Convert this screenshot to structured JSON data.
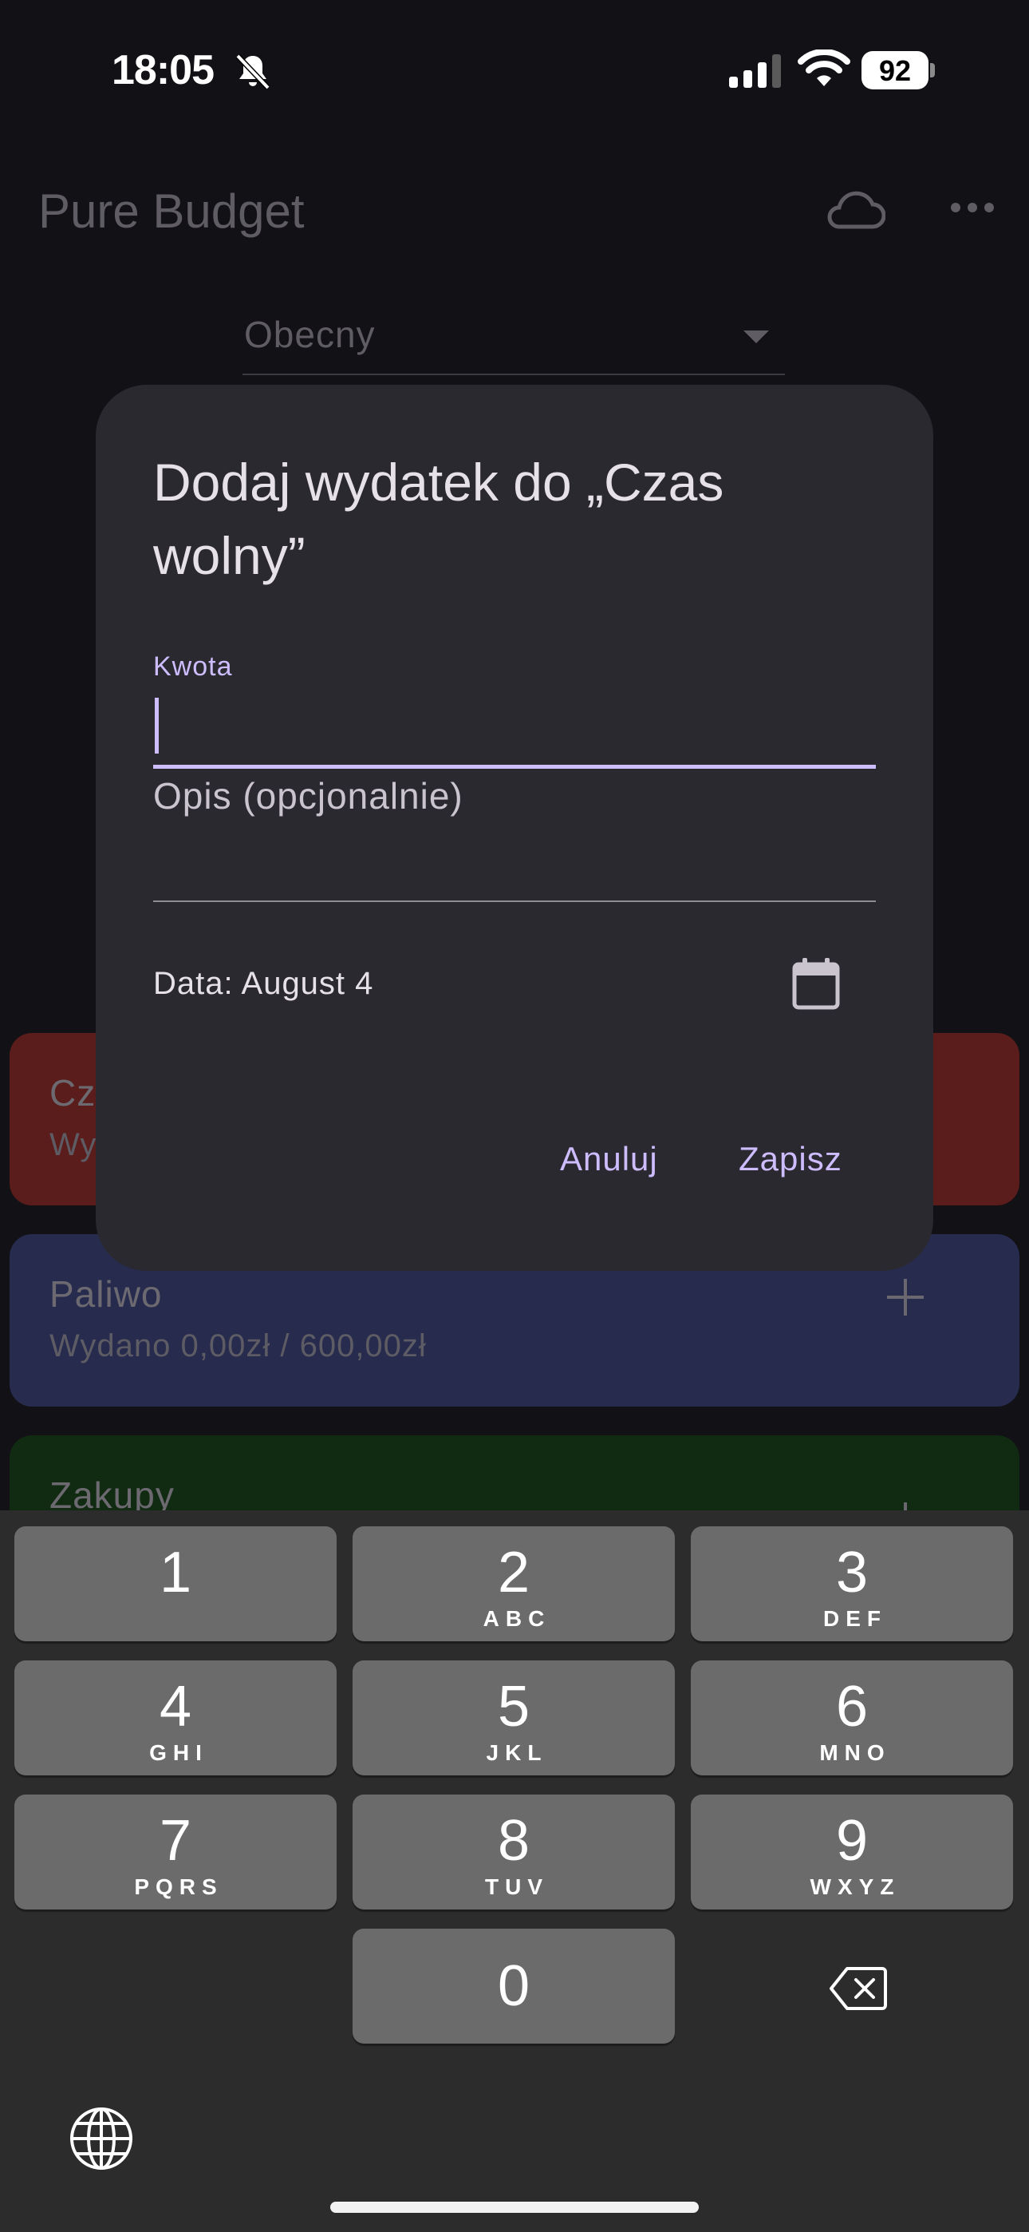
{
  "status_bar": {
    "time": "18:05",
    "battery": "92"
  },
  "app": {
    "title": "Pure Budget",
    "period": "Obecny"
  },
  "categories": [
    {
      "name": "Cz",
      "subtitle": "Wy"
    },
    {
      "name": "Paliwo",
      "subtitle": "Wydano 0,00zł / 600,00zł"
    },
    {
      "name": "Zakupy",
      "subtitle": ""
    }
  ],
  "dialog": {
    "title": "Dodaj wydatek do „Czas wolny”",
    "amount_label": "Kwota",
    "amount_value": "",
    "description_placeholder": "Opis (opcjonalnie)",
    "date_label": "Data: August 4",
    "cancel": "Anuluj",
    "save": "Zapisz"
  },
  "keyboard": {
    "keys": [
      {
        "digit": "1",
        "letters": ""
      },
      {
        "digit": "2",
        "letters": "ABC"
      },
      {
        "digit": "3",
        "letters": "DEF"
      },
      {
        "digit": "4",
        "letters": "GHI"
      },
      {
        "digit": "5",
        "letters": "JKL"
      },
      {
        "digit": "6",
        "letters": "MNO"
      },
      {
        "digit": "7",
        "letters": "PQRS"
      },
      {
        "digit": "8",
        "letters": "TUV"
      },
      {
        "digit": "9",
        "letters": "WXYZ"
      },
      {
        "digit": "0",
        "letters": ""
      }
    ]
  },
  "colors": {
    "accent": "#cdbdff",
    "dialog_bg": "#2b2930",
    "card_red": "#5a1d1b",
    "card_blue": "#272b4e",
    "card_green": "#112a12"
  },
  "icons": [
    "bell-slash-icon",
    "signal-icon",
    "wifi-icon",
    "cloud-icon",
    "more-icon",
    "calendar-icon",
    "backspace-icon",
    "globe-icon"
  ]
}
